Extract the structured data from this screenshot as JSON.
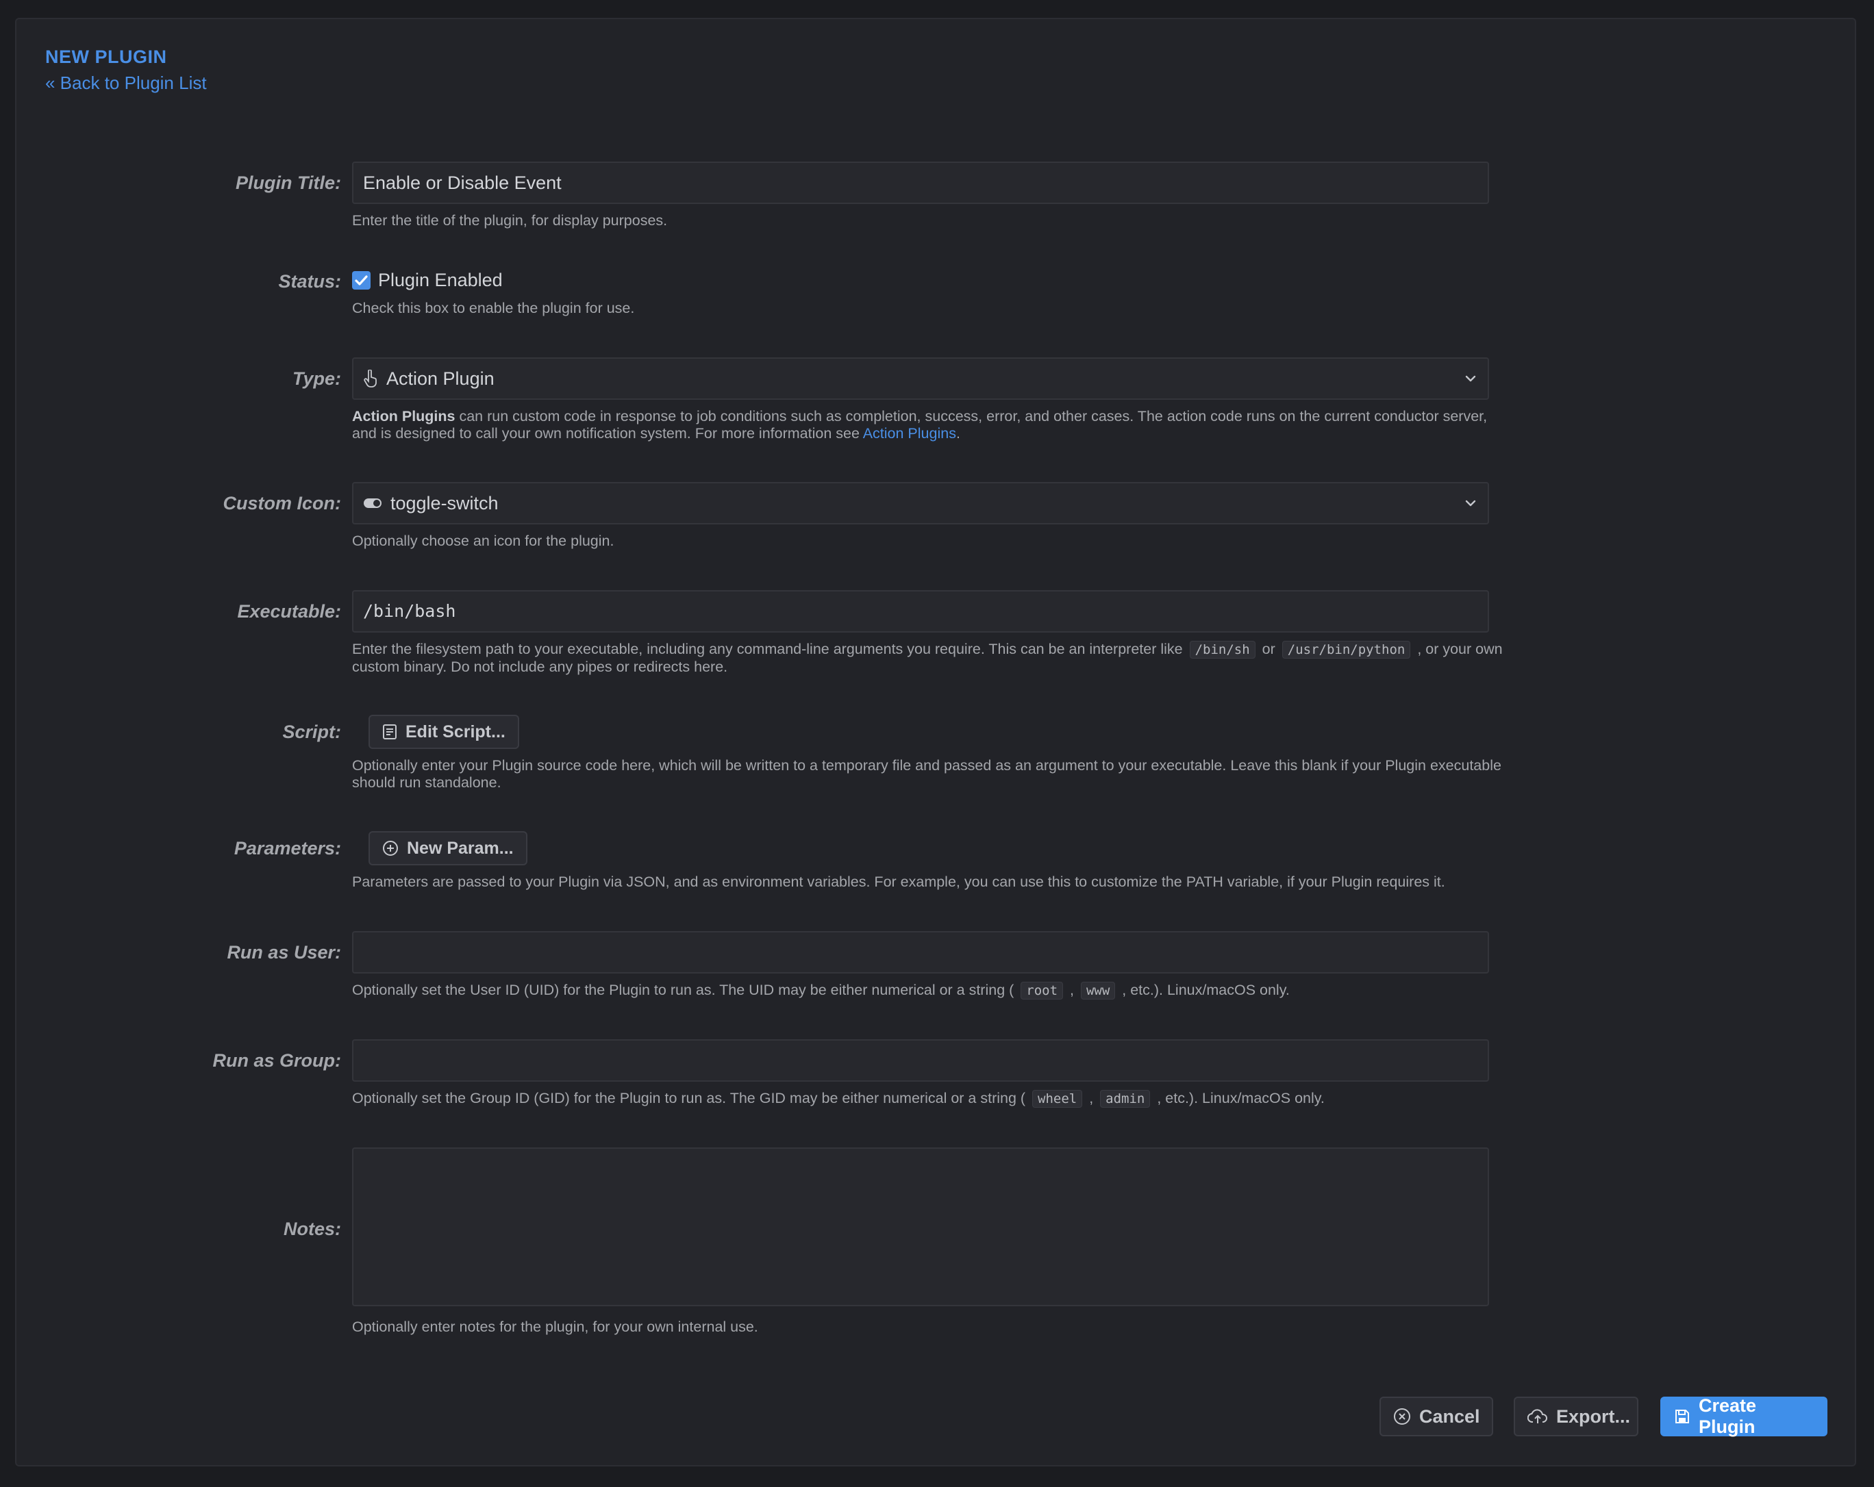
{
  "header": {
    "title": "NEW PLUGIN",
    "back_link": "« Back to Plugin List"
  },
  "form": {
    "title": {
      "label": "Plugin Title:",
      "value": "Enable or Disable Event",
      "hint": "Enter the title of the plugin, for display purposes."
    },
    "status": {
      "label": "Status:",
      "checkbox_label": "Plugin Enabled",
      "checked": true,
      "hint": "Check this box to enable the plugin for use."
    },
    "type": {
      "label": "Type:",
      "value": "Action Plugin",
      "icon": "hand-pointer-icon",
      "hint_bold": "Action Plugins",
      "hint_text": " can run custom code in response to job conditions such as completion, success, error, and other cases. The action code runs on the current conductor server, and is designed to call your own notification system. For more information see ",
      "hint_link": "Action Plugins",
      "hint_end": "."
    },
    "custom_icon": {
      "label": "Custom Icon:",
      "value": "toggle-switch",
      "icon": "toggle-switch-icon",
      "hint": "Optionally choose an icon for the plugin."
    },
    "executable": {
      "label": "Executable:",
      "value": "/bin/bash",
      "hint_a": "Enter the filesystem path to your executable, including any command-line arguments you require. This can be an interpreter like ",
      "code_1": "/bin/sh",
      "hint_b": " or ",
      "code_2": "/usr/bin/python",
      "hint_c": " , or your own custom binary. Do not include any pipes or redirects here."
    },
    "script": {
      "label": "Script:",
      "button": "Edit Script...",
      "hint": "Optionally enter your Plugin source code here, which will be written to a temporary file and passed as an argument to your executable. Leave this blank if your Plugin executable should run standalone."
    },
    "parameters": {
      "label": "Parameters:",
      "button": "New Param...",
      "hint": "Parameters are passed to your Plugin via JSON, and as environment variables. For example, you can use this to customize the PATH variable, if your Plugin requires it."
    },
    "run_as_user": {
      "label": "Run as User:",
      "value": "",
      "hint_a": "Optionally set the User ID (UID) for the Plugin to run as. The UID may be either numerical or a string ( ",
      "code_1": "root",
      "hint_b": " , ",
      "code_2": "www",
      "hint_c": " , etc.). Linux/macOS only."
    },
    "run_as_group": {
      "label": "Run as Group:",
      "value": "",
      "hint_a": "Optionally set the Group ID (GID) for the Plugin to run as. The GID may be either numerical or a string ( ",
      "code_1": "wheel",
      "hint_b": " , ",
      "code_2": "admin",
      "hint_c": " , etc.). Linux/macOS only."
    },
    "notes": {
      "label": "Notes:",
      "value": "",
      "hint": "Optionally enter notes for the plugin, for your own internal use."
    }
  },
  "footer": {
    "cancel": "Cancel",
    "export": "Export...",
    "create": "Create Plugin"
  },
  "colors": {
    "accent": "#4a8fe6",
    "primary_button": "#3f8fea",
    "background": "#1b1c20",
    "panel": "#222328"
  }
}
